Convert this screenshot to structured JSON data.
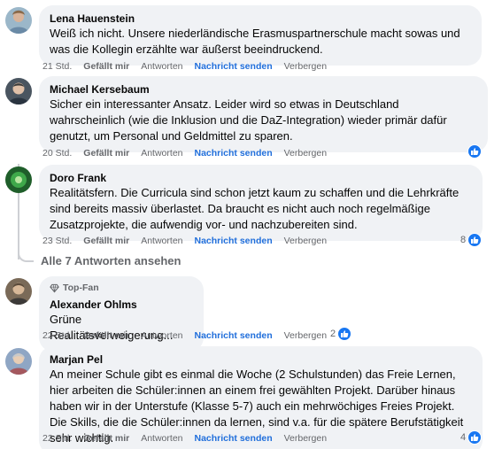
{
  "comments": [
    {
      "author": "Lena Hauenstein",
      "text": "Weiß ich nicht. Unsere niederländische Erasmuspartnerschule macht sowas und was die Kollegin erzählte war äußerst beeindruckend.",
      "time": "21 Std.",
      "like_label": "Gefällt mir",
      "reply_label": "Antworten",
      "message_label": "Nachricht senden",
      "hide_label": "Verbergen",
      "reactions": ""
    },
    {
      "author": "Michael Kersebaum",
      "text": "Sicher ein interessanter Ansatz. Leider wird so etwas in Deutschland wahrscheinlich (wie die Inklusion und die DaZ-Integration) wieder primär dafür genutzt, um Personal und Geldmittel zu sparen.",
      "time": "20 Std.",
      "like_label": "Gefällt mir",
      "reply_label": "Antworten",
      "message_label": "Nachricht senden",
      "hide_label": "Verbergen",
      "reactions": ""
    },
    {
      "author": "Doro Frank",
      "text": "Realitätsfern. Die Curricula sind schon jetzt kaum zu schaffen und die Lehrkräfte sind bereits massiv überlastet. Da braucht es nicht auch noch regelmäßige Zusatzprojekte, die aufwendig vor- und nachzubereiten sind.",
      "time": "23 Std.",
      "like_label": "Gefällt mir",
      "reply_label": "Antworten",
      "message_label": "Nachricht senden",
      "hide_label": "Verbergen",
      "reactions": "8"
    },
    {
      "badge": "Top-Fan",
      "author": "Alexander Ohlms",
      "text": "Grüne Realitätsverweigerung...",
      "time": "22 Std.",
      "like_label": "Gefällt mir",
      "reply_label": "Antworten",
      "message_label": "Nachricht senden",
      "hide_label": "Verbergen",
      "reactions": "2"
    },
    {
      "author": "Marjan Pel",
      "text": "An meiner Schule gibt es einmal die Woche (2 Schulstunden) das Freie Lernen, hier arbeiten die Schüler:innen an einem frei gewählten Projekt. Darüber hinaus haben wir in der Unterstufe (Klasse 5-7) auch ein mehrwöchiges Freies Projekt. Die Skills, die die Schüler:innen da lernen, sind v.a. für die spätere Berufstätigkeit sehr wichtig.",
      "time": "22 Std.",
      "like_label": "Gefällt mir",
      "reply_label": "Antworten",
      "message_label": "Nachricht senden",
      "hide_label": "Verbergen",
      "reactions": "4"
    }
  ],
  "more_replies": "Alle 7 Antworten ansehen",
  "icons": {
    "like": "thumbs-up-icon",
    "badge": "diamond-icon"
  },
  "colors": {
    "link": "#216fdb",
    "like_badge": "#1877f2",
    "bubble": "#f0f2f5"
  }
}
